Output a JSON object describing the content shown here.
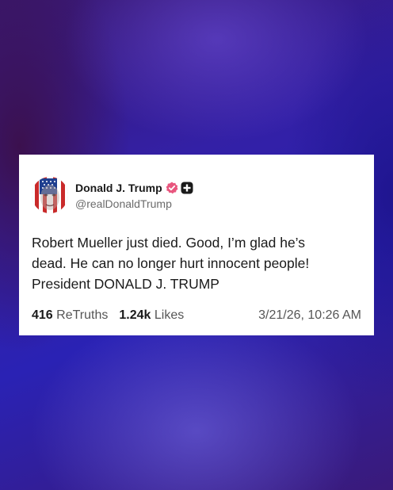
{
  "post": {
    "display_name": "Donald J. Trump",
    "handle": "@realDonaldTrump",
    "body": "Robert Mueller just died. Good, I’m glad he’s\ndead. He can no longer hurt innocent people!\nPresident DONALD J. TRUMP",
    "retruths_count": "416",
    "retruths_label": "ReTruths",
    "likes_count": "1.24k",
    "likes_label": "Likes",
    "timestamp": "3/21/26, 10:26 AM"
  },
  "icons": {
    "avatar": "flag-face-avatar",
    "verified": "verified-badge-icon",
    "plus": "plus-badge-icon"
  },
  "colors": {
    "verified_badge": "#e8567e",
    "card_background": "#ffffff",
    "text_primary": "#1a1a1a",
    "text_secondary": "#6b6b6b"
  }
}
